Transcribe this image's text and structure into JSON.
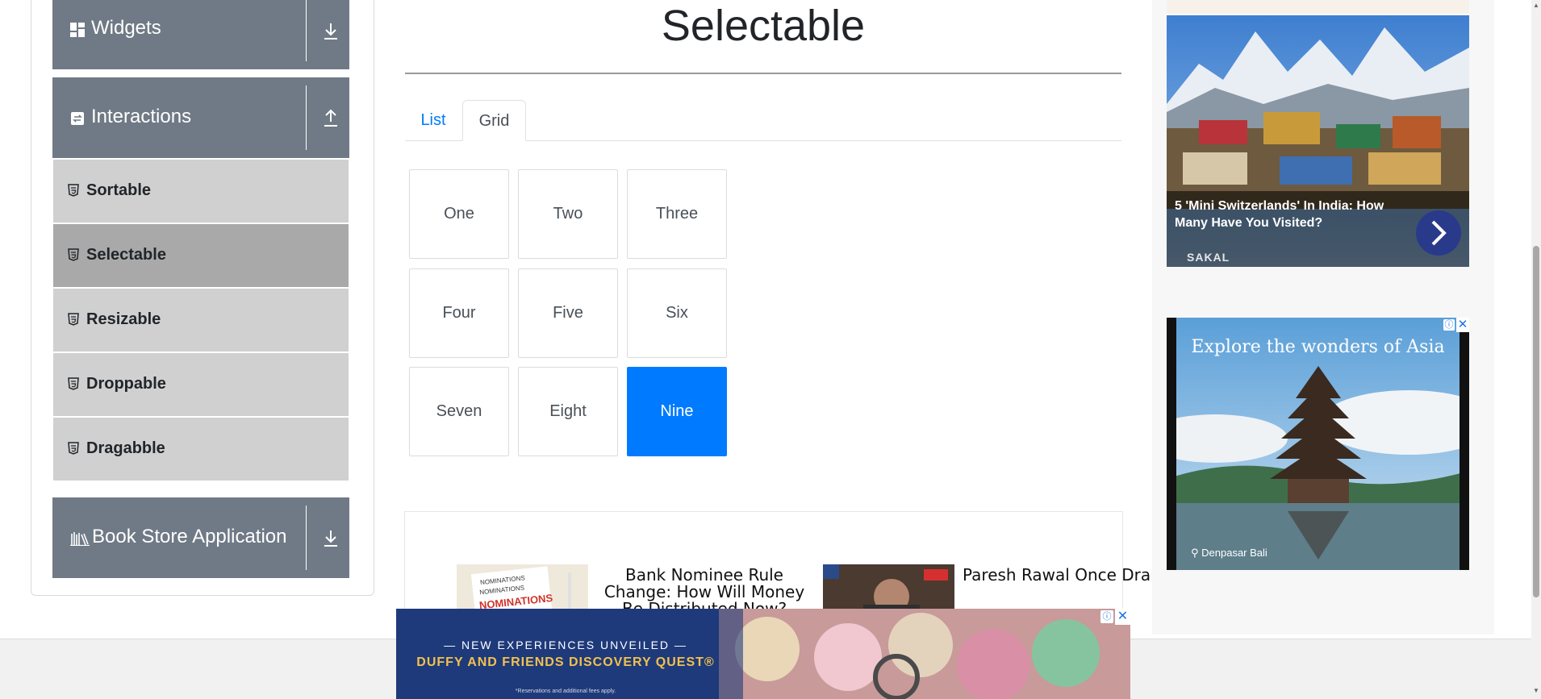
{
  "sidebar": {
    "widgets_label": "Widgets",
    "interactions_label": "Interactions",
    "items": [
      {
        "label": "Sortable"
      },
      {
        "label": "Selectable"
      },
      {
        "label": "Resizable"
      },
      {
        "label": "Droppable"
      },
      {
        "label": "Dragabble"
      }
    ],
    "book_store_label": "Book Store Application"
  },
  "main": {
    "title": "Selectable",
    "tabs": [
      {
        "label": "List"
      },
      {
        "label": "Grid"
      }
    ],
    "active_tab": "Grid",
    "grid_items": [
      "One",
      "Two",
      "Three",
      "Four",
      "Five",
      "Six",
      "Seven",
      "Eight",
      "Nine"
    ],
    "selected_item": "Nine"
  },
  "news": [
    {
      "title": "Bank Nominee Rule Change: How Will Money Be Distributed Now?"
    },
    {
      "title": "Paresh Rawal Once Drank Urine For Health"
    }
  ],
  "ads": {
    "right_top": {
      "headline": "5 'Mini Switzerlands' In India: How Many Have You Visited?",
      "source": "SAKAL"
    },
    "right_bottom": {
      "headline": "Explore the wonders of Asia",
      "location": "Denpasar Bali"
    },
    "bottom": {
      "kicker": "— NEW EXPERIENCES UNVEILED —",
      "headline": "DUFFY AND FRIENDS DISCOVERY QUEST®",
      "fine_print": "*Reservations and additional fees apply."
    }
  },
  "colors": {
    "accent": "#007bff",
    "sidebar_header": "#707a86",
    "menu_item": "#d0d0d0",
    "menu_item_active": "#a9a9a9"
  }
}
